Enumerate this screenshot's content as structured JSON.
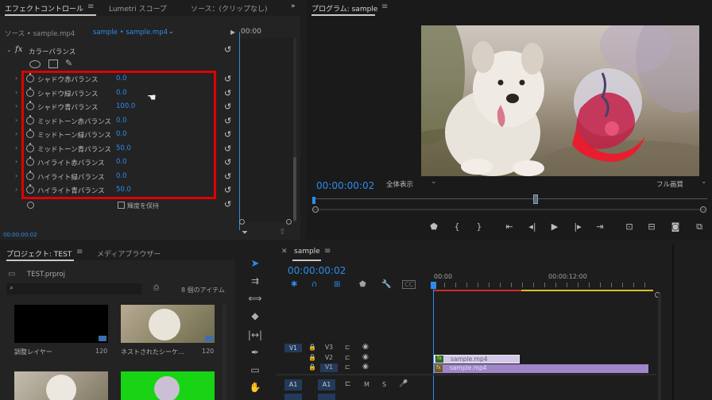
{
  "effect_controls": {
    "tabs": [
      "エフェクトコントロール",
      "Lumetri スコープ",
      "ソース：(クリップなし)"
    ],
    "source_label": "ソース • sample.mp4",
    "sequence_label": "sample • sample.mp4",
    "ruler_time": "00:00",
    "effect_name": "カラーバランス",
    "fx_label": "fx",
    "params": [
      {
        "label": "シャドウ赤バランス",
        "value": "0.0"
      },
      {
        "label": "シャドウ緑バランス",
        "value": "0.0"
      },
      {
        "label": "シャドウ青バランス",
        "value": "100.0"
      },
      {
        "label": "ミッドトーン赤バランス",
        "value": "0.0"
      },
      {
        "label": "ミッドトーン緑バランス",
        "value": "0.0"
      },
      {
        "label": "ミッドトーン青バランス",
        "value": "50.0"
      },
      {
        "label": "ハイライト赤バランス",
        "value": "0.0"
      },
      {
        "label": "ハイライト緑バランス",
        "value": "0.0"
      },
      {
        "label": "ハイライト青バランス",
        "value": "50.0"
      }
    ],
    "preserve_luminosity": "輝度を保持",
    "timecode": "00:00:00:02",
    "highlight_color": "#e00000"
  },
  "program": {
    "title": "プログラム: sample",
    "timecode": "00:00:00:02",
    "zoom": "全体表示",
    "quality": "フル画質"
  },
  "project": {
    "tabs": [
      "プロジェクト: TEST",
      "メディアブラウザー"
    ],
    "file": "TEST.prproj",
    "item_count": "8 個のアイテム",
    "items": [
      {
        "name": "調整レイヤー",
        "value": "120"
      },
      {
        "name": "ネストされたシーケ…",
        "value": "120"
      }
    ]
  },
  "timeline": {
    "tab": "sample",
    "timecode": "00:00:00:02",
    "ruler": [
      "00:00",
      "00:00:12:00"
    ],
    "tracks": [
      {
        "patch": "V1",
        "name": "V3"
      },
      {
        "patch": "",
        "name": "V2"
      },
      {
        "patch": "",
        "name": "V1"
      }
    ],
    "audio": [
      {
        "patch": "A1",
        "name": "A1",
        "m": "M",
        "s": "S"
      }
    ],
    "clips": [
      "sample.mp4",
      "sample.mp4"
    ],
    "fx_badge": "fx"
  },
  "colors": {
    "accent": "#2d8ceb",
    "clip_purple": "#9f85c9",
    "clip_lavender": "#d3c8e8"
  }
}
